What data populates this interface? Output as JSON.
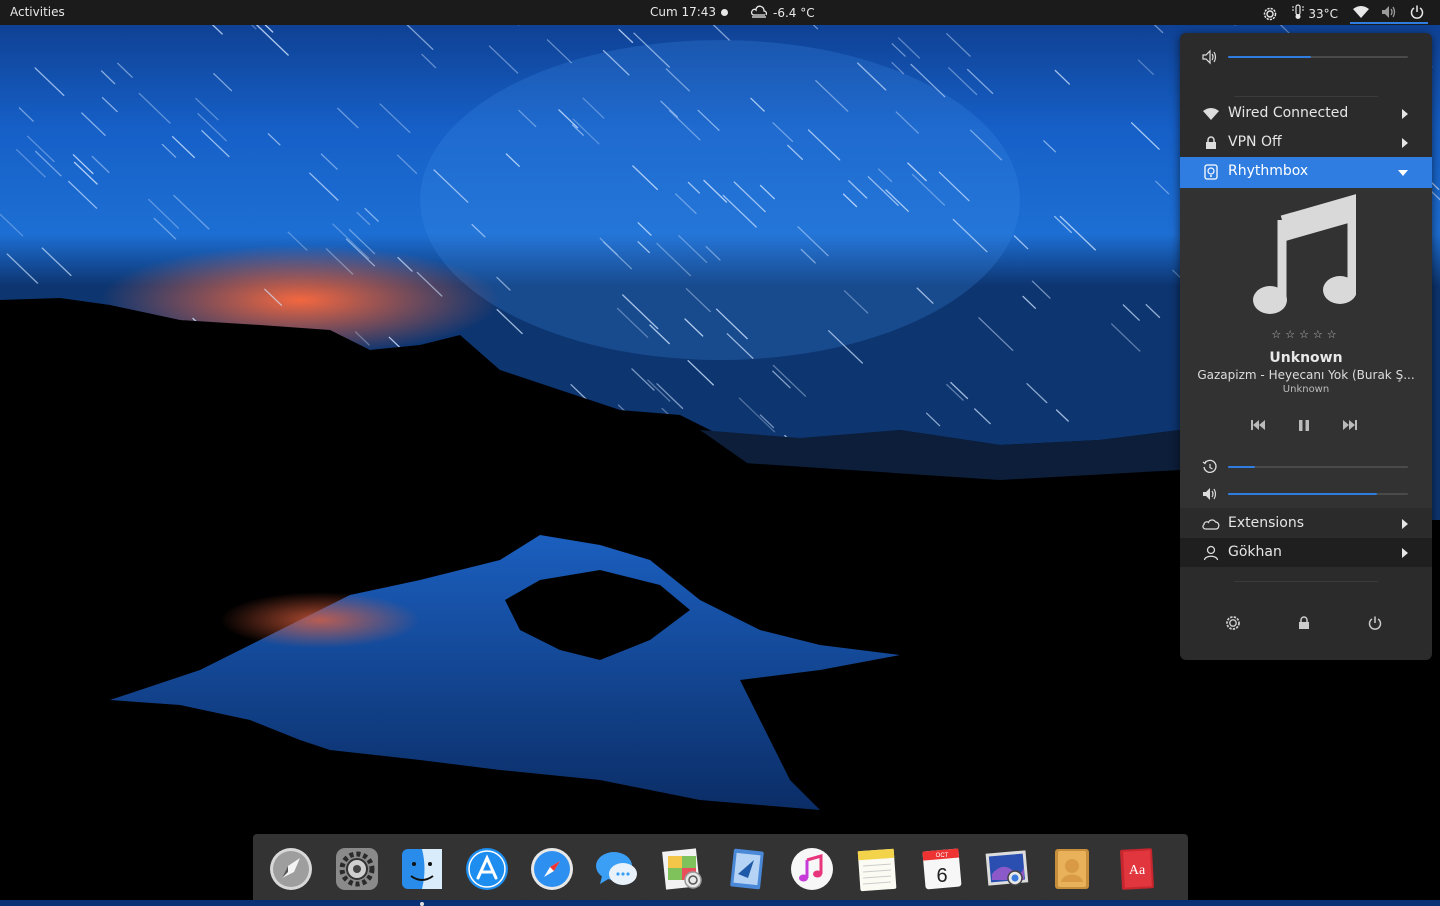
{
  "topbar": {
    "activities": "Activities",
    "clock": "Cum 17:43",
    "weather": "-6.4 °C",
    "cpu_temp": "33°C",
    "icons": [
      "gear-icon",
      "thermometer-icon",
      "wifi-icon",
      "volume-icon",
      "power-icon"
    ]
  },
  "panel": {
    "volume_level": 0.46,
    "items": {
      "wired": "Wired Connected",
      "vpn": "VPN Off",
      "rhythmbox": "Rhythmbox",
      "extensions": "Extensions",
      "user": "Gökhan"
    },
    "player": {
      "rating": "☆☆☆☆☆",
      "title": "Unknown",
      "artist": "Gazapizm - Heyecanı Yok (Burak Ş...",
      "album": "Unknown",
      "progress": 0.15,
      "volume": 0.83
    },
    "bottom_icons": [
      "settings-icon",
      "lock-icon",
      "power-icon"
    ]
  },
  "dock": {
    "apps": [
      "Launchpad",
      "System Preferences",
      "Finder",
      "App Store",
      "Safari",
      "Messages",
      "Photos",
      "Mail",
      "iTunes",
      "Notes",
      "Calendar",
      "Image Viewer",
      "Contacts",
      "Dictionary"
    ],
    "calendar": {
      "month": "OCT",
      "day": "6"
    },
    "dictionary_label": "Aa",
    "accent": "#2f7de1"
  }
}
